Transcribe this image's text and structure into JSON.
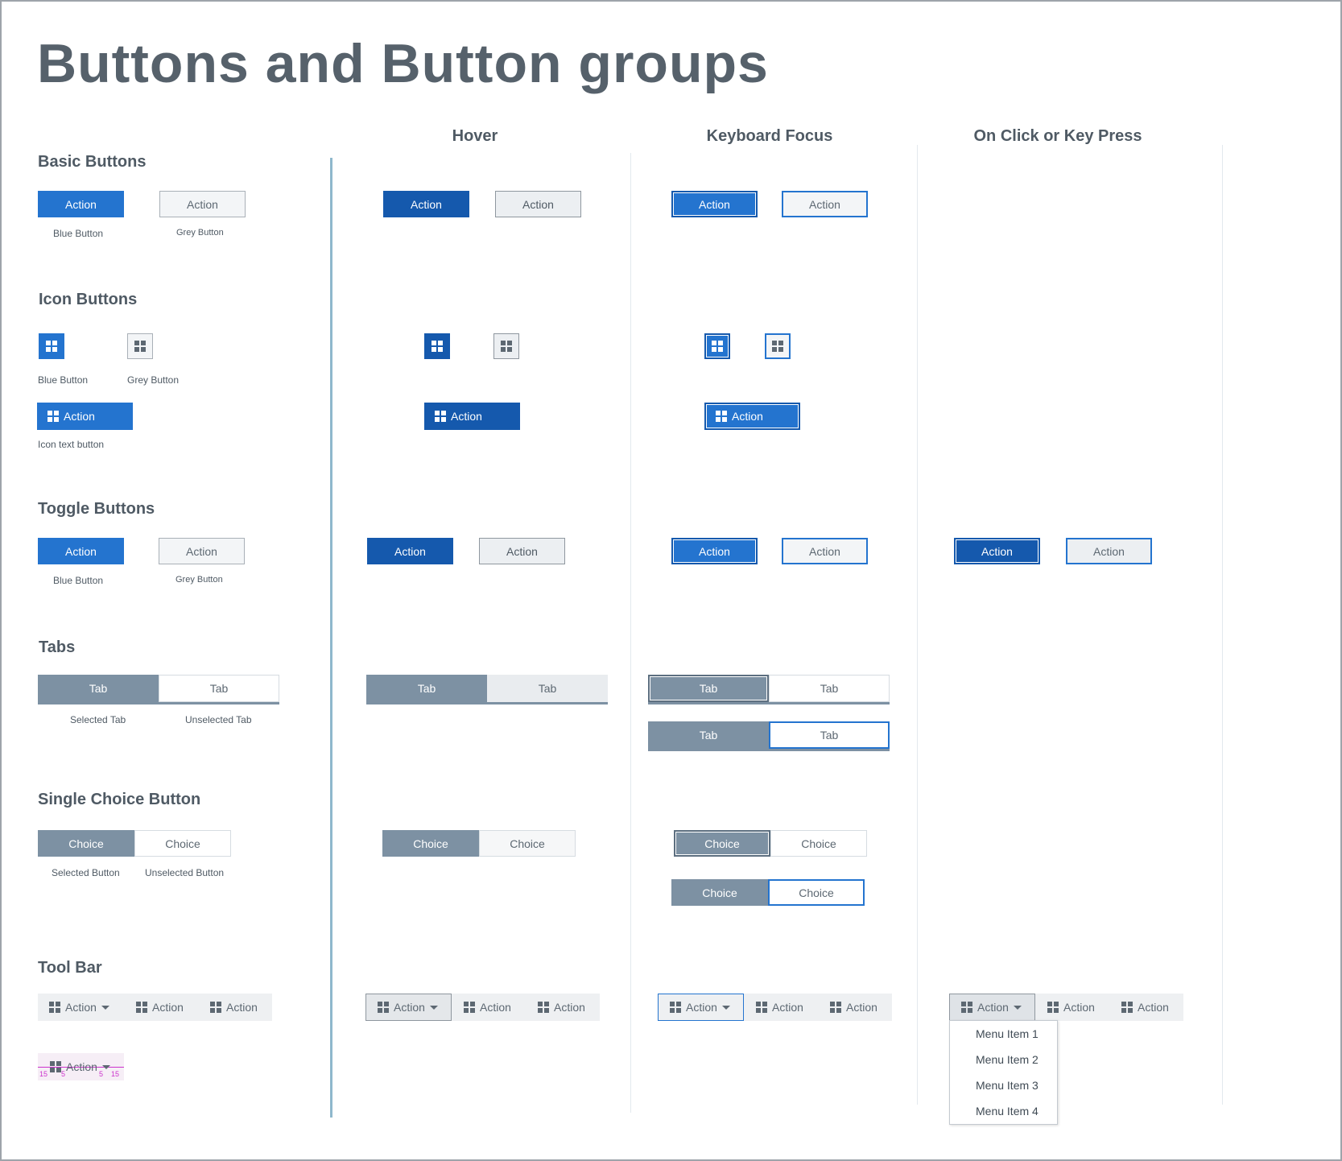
{
  "title": "Buttons and Button groups",
  "columns": {
    "hover": "Hover",
    "focus": "Keyboard Focus",
    "press": "On Click or Key Press"
  },
  "sections": {
    "basic": "Basic Buttons",
    "icon": "Icon Buttons",
    "toggle": "Toggle Buttons",
    "tabs": "Tabs",
    "single": "Single Choice Button",
    "toolbar": "Tool Bar"
  },
  "labels": {
    "action": "Action",
    "tab": "Tab",
    "choice": "Choice"
  },
  "captions": {
    "blue_button": "Blue Button",
    "grey_button": "Grey Button",
    "icon_text_button": "Icon text button",
    "selected_tab": "Selected Tab",
    "unselected_tab": "Unselected Tab",
    "selected_button": "Selected Button",
    "unselected_button": "Unselected Button"
  },
  "menu": [
    "Menu Item 1",
    "Menu Item 2",
    "Menu Item 3",
    "Menu Item 4"
  ],
  "spec": {
    "a": "15",
    "b": "5",
    "c": "5",
    "d": "15"
  },
  "colors": {
    "blue": "#2474cf",
    "blue_dark": "#1559ad",
    "slate": "#7d91a3",
    "spec": "#cc33cc"
  },
  "icons": {
    "grid": "grid-icon",
    "caret": "caret-down-icon"
  }
}
